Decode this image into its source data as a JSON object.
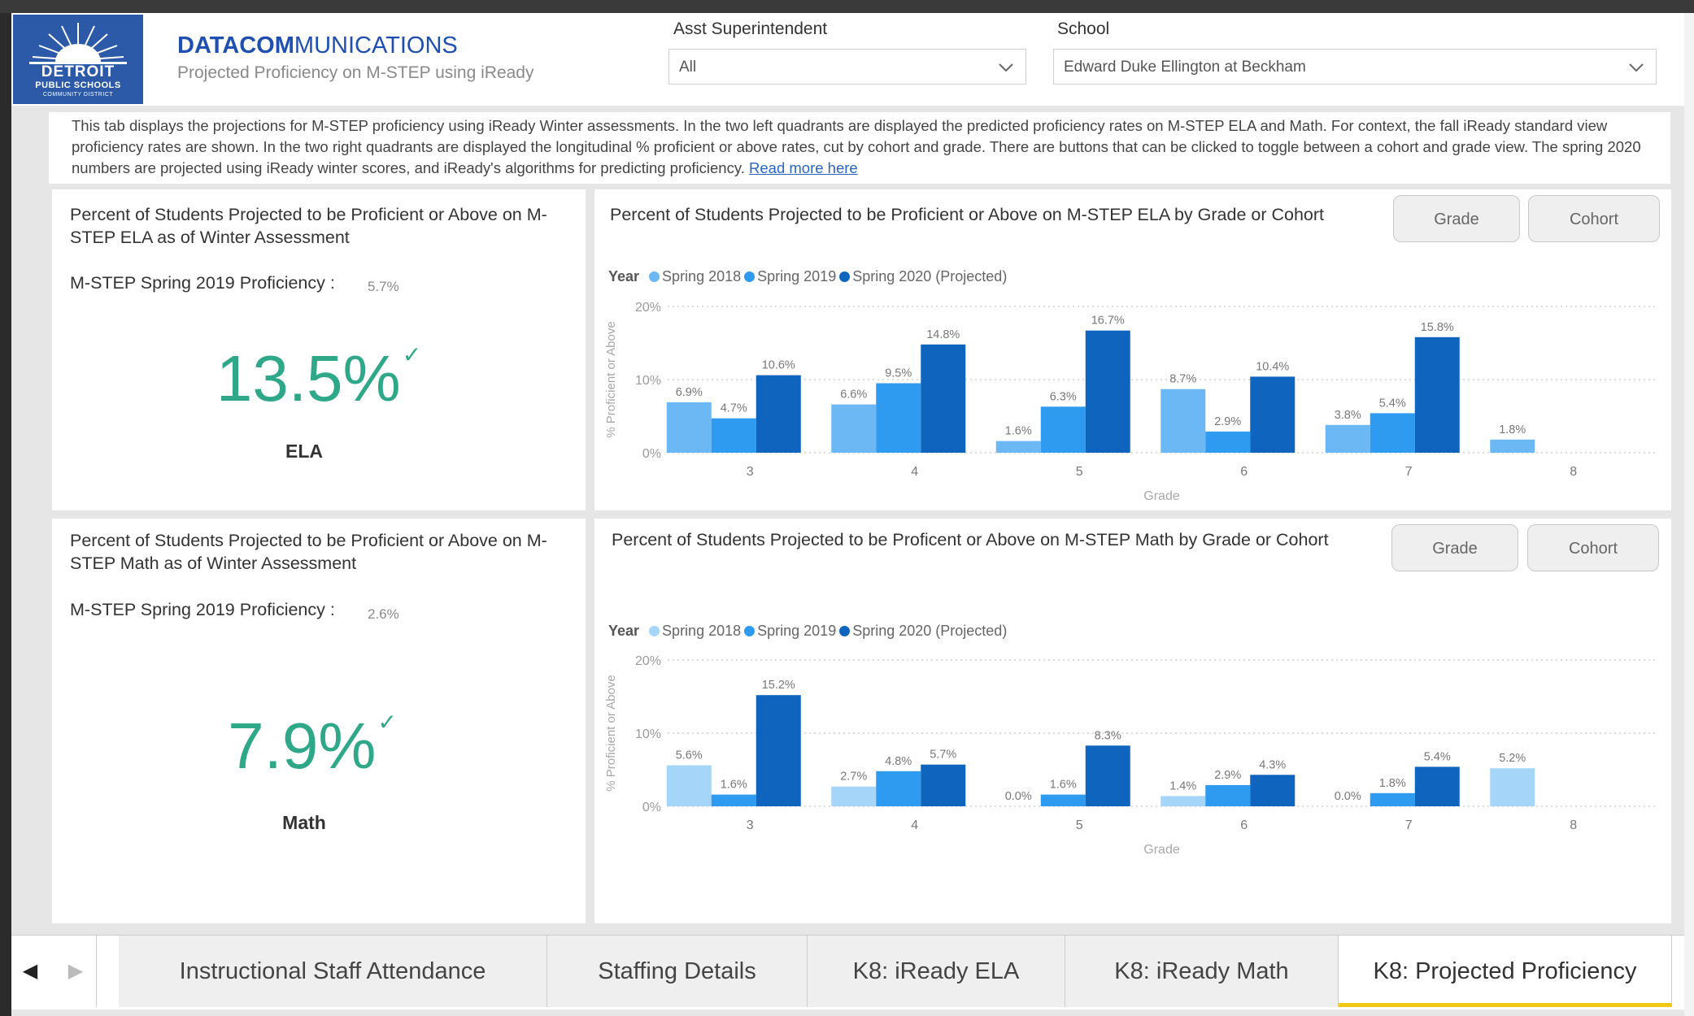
{
  "header": {
    "brand_bold": "DATACOM",
    "brand_light": "MUNICATIONS",
    "subtitle": "Projected Proficiency on M-STEP using iReady",
    "logo": {
      "line1": "DETROIT",
      "line2": "PUBLIC SCHOOLS",
      "line3": "COMMUNITY DISTRICT"
    }
  },
  "filters": {
    "asst_label": "Asst Superintendent",
    "asst_value": "All",
    "school_label": "School",
    "school_value": "Edward Duke Ellington at Beckham"
  },
  "description": {
    "text": "This tab displays the projections for M-STEP proficiency using iReady Winter assessments. In the two left quadrants are displayed the predicted proficiency rates on M-STEP ELA and Math. For context, the fall iReady standard view proficiency rates are shown. In the two right quadrants are displayed the longitudinal % proficient or above rates, cut by cohort and grade. There are buttons that can be clicked to toggle between a cohort and grade view. The spring 2020 numbers are projected using iReady winter scores, and iReady's algorithms for predicting proficiency.",
    "link": "Read more here"
  },
  "ela_card": {
    "title": "Percent of Students Projected to be Proficient or Above on M-STEP ELA as of Winter Assessment",
    "prof_label": "M-STEP Spring 2019 Proficiency :",
    "prof_value": "5.7%",
    "big_value": "13.5%",
    "subject": "ELA"
  },
  "math_card": {
    "title": "Percent of Students Projected to be Proficient or Above on M-STEP Math as of Winter Assessment",
    "prof_label": "M-STEP Spring 2019 Proficiency :",
    "prof_value": "2.6%",
    "big_value": "7.9%",
    "subject": "Math"
  },
  "ela_chart_card": {
    "title": "Percent of Students Projected to be Proficient or Above on M-STEP ELA by Grade or Cohort",
    "grade_button": "Grade",
    "cohort_button": "Cohort"
  },
  "math_chart_card": {
    "title": "Percent of Students Projected to be Proficent or Above on M-STEP Math by Grade or Cohort",
    "grade_button": "Grade",
    "cohort_button": "Cohort"
  },
  "legend": {
    "title": "Year",
    "items": [
      "Spring 2018",
      "Spring 2019",
      "Spring 2020 (Projected)"
    ]
  },
  "colors": {
    "s2018": "#6cb8f5",
    "s2019": "#2e9bf0",
    "s2020": "#0f65be",
    "s2018_math": "#a6d5fa",
    "accent": "#2fa88a",
    "tab_underline": "#f2c811"
  },
  "tabs": [
    "Instructional Staff Attendance",
    "Staffing Details",
    "K8: iReady ELA",
    "K8: iReady Math",
    "K8: Projected Proficiency"
  ],
  "chart_data": [
    {
      "type": "bar",
      "title": "Percent of Students Projected to be Proficient or Above on M-STEP ELA by Grade or Cohort",
      "xlabel": "Grade",
      "ylabel": "% Proficient or Above",
      "categories": [
        "3",
        "4",
        "5",
        "6",
        "7",
        "8"
      ],
      "yticks": [
        "0%",
        "10%",
        "20%"
      ],
      "ylim": [
        0,
        20
      ],
      "grid": true,
      "legend_position": "top-left",
      "series": [
        {
          "name": "Spring 2018",
          "values": [
            6.9,
            6.6,
            1.6,
            8.7,
            3.8,
            1.8
          ],
          "labels": [
            "6.9%",
            "6.6%",
            "1.6%",
            "8.7%",
            "3.8%",
            "1.8%"
          ]
        },
        {
          "name": "Spring 2019",
          "values": [
            4.7,
            9.5,
            6.3,
            2.9,
            5.4,
            null
          ],
          "labels": [
            "4.7%",
            "9.5%",
            "6.3%",
            "2.9%",
            "5.4%",
            ""
          ]
        },
        {
          "name": "Spring 2020 (Projected)",
          "values": [
            10.6,
            14.8,
            16.7,
            10.4,
            15.8,
            null
          ],
          "labels": [
            "10.6%",
            "14.8%",
            "16.7%",
            "10.4%",
            "15.8%",
            ""
          ]
        }
      ]
    },
    {
      "type": "bar",
      "title": "Percent of Students Projected to be Proficent or Above on M-STEP Math by Grade or Cohort",
      "xlabel": "Grade",
      "ylabel": "% Proficient or Above",
      "categories": [
        "3",
        "4",
        "5",
        "6",
        "7",
        "8"
      ],
      "yticks": [
        "0%",
        "10%",
        "20%"
      ],
      "ylim": [
        0,
        20
      ],
      "grid": true,
      "legend_position": "top-left",
      "series": [
        {
          "name": "Spring 2018",
          "values": [
            5.6,
            2.7,
            0.0,
            1.4,
            0.0,
            5.2
          ],
          "labels": [
            "5.6%",
            "2.7%",
            "0.0%",
            "1.4%",
            "0.0%",
            "5.2%"
          ]
        },
        {
          "name": "Spring 2019",
          "values": [
            1.6,
            4.8,
            1.6,
            2.9,
            1.8,
            null
          ],
          "labels": [
            "1.6%",
            "4.8%",
            "1.6%",
            "2.9%",
            "1.8%",
            ""
          ]
        },
        {
          "name": "Spring 2020 (Projected)",
          "values": [
            15.2,
            5.7,
            8.3,
            4.3,
            5.4,
            null
          ],
          "labels": [
            "15.2%",
            "5.7%",
            "8.3%",
            "4.3%",
            "5.4%",
            ""
          ]
        }
      ]
    }
  ]
}
